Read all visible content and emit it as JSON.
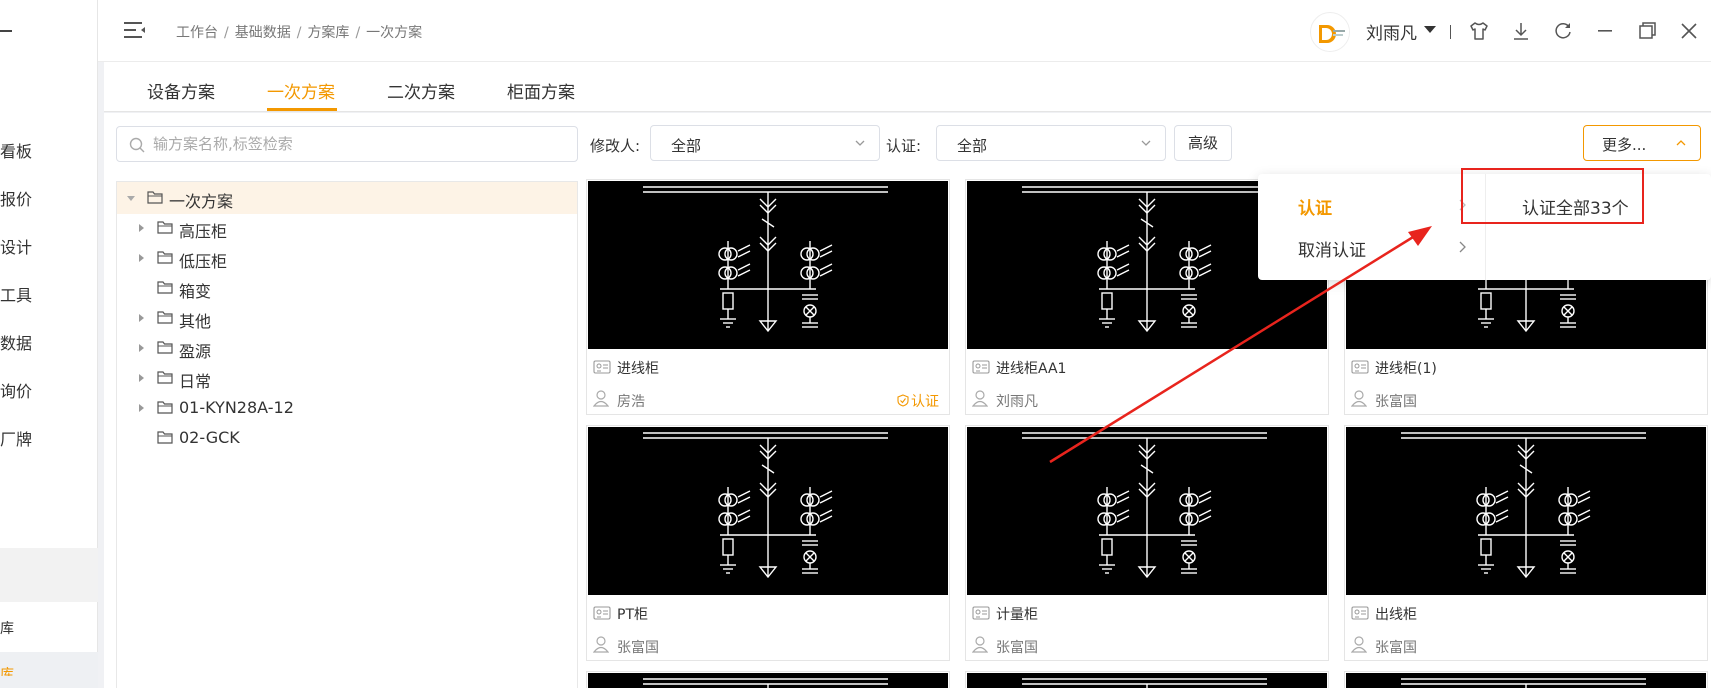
{
  "sidebar": {
    "items": [
      "看板",
      "报价",
      "设计",
      "工具",
      "数据",
      "询价",
      "厂牌",
      "库",
      "库"
    ]
  },
  "header": {
    "breadcrumb": [
      "工作台",
      "基础数据",
      "方案库",
      "一次方案"
    ],
    "breadcrumb_sep": "/",
    "user_name": "刘雨凡"
  },
  "tabs": [
    "设备方案",
    "一次方案",
    "二次方案",
    "柜面方案"
  ],
  "active_tab": "一次方案",
  "search": {
    "placeholder": "输方案名称,标签检索"
  },
  "tree": {
    "root": "一次方案",
    "children": [
      {
        "label": "高压柜",
        "expandable": true
      },
      {
        "label": "低压柜",
        "expandable": true
      },
      {
        "label": "箱变",
        "expandable": false
      },
      {
        "label": "其他",
        "expandable": true
      },
      {
        "label": "盈源",
        "expandable": true
      },
      {
        "label": "日常",
        "expandable": true
      },
      {
        "label": "01-KYN28A-12",
        "expandable": true
      },
      {
        "label": "02-GCK",
        "expandable": false
      }
    ]
  },
  "filters": {
    "modifier_label": "修改人:",
    "modifier_value": "全部",
    "cert_label": "认证:",
    "cert_value": "全部",
    "advanced_label": "高级",
    "more_label": "更多..."
  },
  "cards": [
    {
      "name": "进线柜",
      "user": "房浩",
      "certified": true,
      "cert_label": "认证"
    },
    {
      "name": "进线柜AA1",
      "user": "刘雨凡",
      "certified": false
    },
    {
      "name": "进线柜(1)",
      "user": "张富国",
      "certified": false
    },
    {
      "name": "PT柜",
      "user": "张富国",
      "certified": false
    },
    {
      "name": "计量柜",
      "user": "张富国",
      "certified": false
    },
    {
      "name": "出线柜",
      "user": "张富国",
      "certified": false
    }
  ],
  "dropdown": {
    "items": [
      "认证",
      "取消认证"
    ],
    "sub_item": "认证全部33个"
  },
  "colors": {
    "accent": "#f39800",
    "annotation": "#e8241d"
  }
}
